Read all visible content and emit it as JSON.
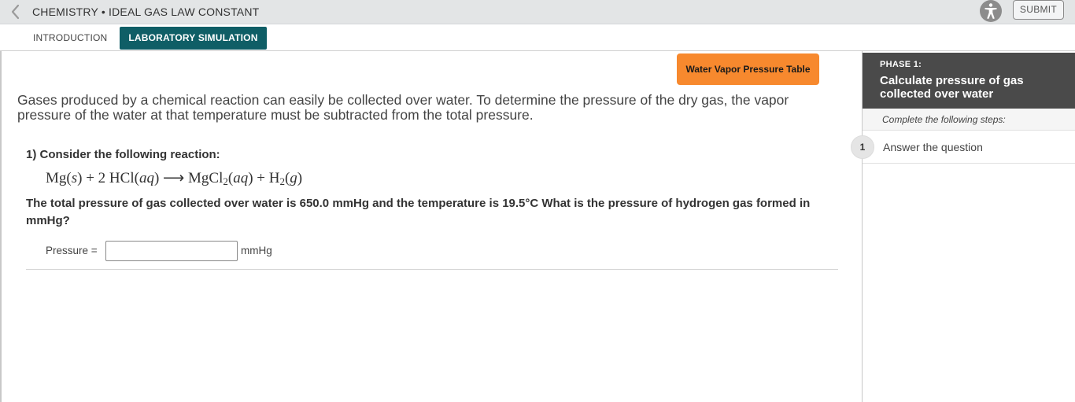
{
  "header": {
    "title": "CHEMISTRY • IDEAL GAS LAW CONSTANT",
    "submit_label": "SUBMIT",
    "back_icon": "chevron-left-icon",
    "accessibility_icon": "accessibility-icon"
  },
  "tabs": [
    {
      "label": "INTRODUCTION",
      "active": false
    },
    {
      "label": "LABORATORY SIMULATION",
      "active": true
    }
  ],
  "main": {
    "vapor_button_label": "Water Vapor Pressure Table",
    "intro_text": "Gases produced by a chemical reaction can easily be collected over water. To determine the pressure of the dry gas, the vapor pressure of the water at that temperature must be subtracted from the total pressure.",
    "question_title": "1) Consider the following reaction:",
    "equation": {
      "lhs1": "Mg(",
      "lhs1_state": "s",
      "plus1": ") + 2 HCl(",
      "lhs2_state": "aq",
      "arrow": ") ⟶ MgCl",
      "sub2": "2",
      "rhs1_open": "(",
      "rhs1_state": "aq",
      "plus2": ") + H",
      "sub3": "2",
      "rhs2_open": "(",
      "rhs2_state": "g",
      "close": ")"
    },
    "question_text": "The total pressure of gas collected over water is 650.0 mmHg and the temperature is 19.5°C What is the pressure of hydrogen gas formed in mmHg?",
    "pressure_label": "Pressure =",
    "pressure_value": "",
    "pressure_unit": "mmHg"
  },
  "sidebar": {
    "phase_label": "PHASE 1:",
    "phase_title": "Calculate pressure of gas collected over water",
    "steps_note": "Complete the following steps:",
    "steps": [
      {
        "number": "1",
        "label": "Answer the question"
      }
    ]
  },
  "colors": {
    "active_tab": "#0f5e66",
    "vapor_button": "#f7892e",
    "phase_header": "#4a4a4a",
    "header_bg": "#e3e5e6"
  }
}
